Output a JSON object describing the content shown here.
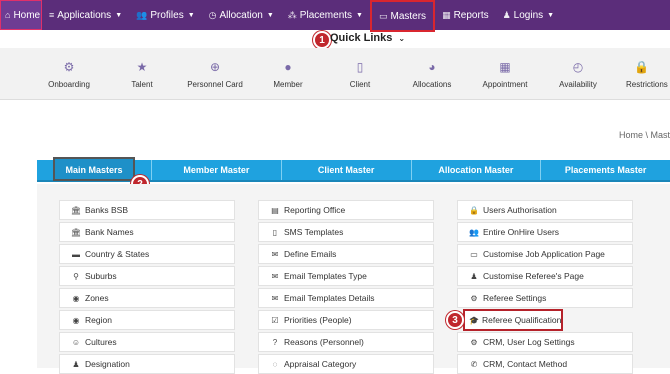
{
  "nav": {
    "items": [
      {
        "label": "Home",
        "icon": "home-icon",
        "glyph": "⌂",
        "caret": false
      },
      {
        "label": "Applications",
        "icon": "list-icon",
        "glyph": "≡",
        "caret": true
      },
      {
        "label": "Profiles",
        "icon": "users-icon",
        "glyph": "👥",
        "caret": true
      },
      {
        "label": "Allocation",
        "icon": "clock-icon",
        "glyph": "◷",
        "caret": true
      },
      {
        "label": "Placements",
        "icon": "sitemap-icon",
        "glyph": "⁂",
        "caret": true
      },
      {
        "label": "Masters",
        "icon": "window-icon",
        "glyph": "▭",
        "caret": false
      },
      {
        "label": "Reports",
        "icon": "chart-icon",
        "glyph": "▦",
        "caret": false
      },
      {
        "label": "Logins",
        "icon": "user-icon",
        "glyph": "♟",
        "caret": true
      }
    ]
  },
  "callouts": [
    "1",
    "2",
    "3"
  ],
  "quick_links": {
    "title": "Quick Links",
    "items": [
      {
        "label": "Onboarding",
        "icon": "gear-icon",
        "glyph": "⚙"
      },
      {
        "label": "Talent",
        "icon": "star-icon",
        "glyph": "★"
      },
      {
        "label": "Personnel Card",
        "icon": "search-icon",
        "glyph": "⊕"
      },
      {
        "label": "Member",
        "icon": "user-icon",
        "glyph": "●"
      },
      {
        "label": "Client",
        "icon": "document-icon",
        "glyph": "▯"
      },
      {
        "label": "Allocations",
        "icon": "pie-chart-icon",
        "glyph": "◕"
      },
      {
        "label": "Appointment",
        "icon": "calendar-icon",
        "glyph": "▦"
      },
      {
        "label": "Availability",
        "icon": "clock-icon",
        "glyph": "◴"
      },
      {
        "label": "Restrictions",
        "icon": "lock-icon",
        "glyph": "🔒"
      }
    ]
  },
  "breadcrumb": "Home \\ Mast",
  "tabs": [
    "Main Masters",
    "Member Master",
    "Client Master",
    "Allocation Master",
    "Placements Master"
  ],
  "columns": [
    [
      {
        "label": "Banks BSB",
        "icon": "bank-icon",
        "glyph": "🏛"
      },
      {
        "label": "Bank Names",
        "icon": "bank-icon",
        "glyph": "🏛"
      },
      {
        "label": "Country & States",
        "icon": "flag-icon",
        "glyph": "▬"
      },
      {
        "label": "Suburbs",
        "icon": "map-marker-icon",
        "glyph": "⚲"
      },
      {
        "label": "Zones",
        "icon": "globe-icon",
        "glyph": "◉"
      },
      {
        "label": "Region",
        "icon": "globe-icon",
        "glyph": "◉"
      },
      {
        "label": "Cultures",
        "icon": "smile-icon",
        "glyph": "☺"
      },
      {
        "label": "Designation",
        "icon": "user-icon",
        "glyph": "♟"
      }
    ],
    [
      {
        "label": "Reporting Office",
        "icon": "file-icon",
        "glyph": "▤"
      },
      {
        "label": "SMS Templates",
        "icon": "mobile-icon",
        "glyph": "▯"
      },
      {
        "label": "Define Emails",
        "icon": "envelope-icon",
        "glyph": "✉"
      },
      {
        "label": "Email Templates Type",
        "icon": "envelope-icon",
        "glyph": "✉"
      },
      {
        "label": "Email Templates Details",
        "icon": "envelope-icon",
        "glyph": "✉"
      },
      {
        "label": "Priorities (People)",
        "icon": "check-square-icon",
        "glyph": "☑"
      },
      {
        "label": "Reasons (Personnel)",
        "icon": "question-circle-icon",
        "glyph": "?"
      },
      {
        "label": "Appraisal Category",
        "icon": "comment-icon",
        "glyph": "◌"
      }
    ],
    [
      {
        "label": "Users Authorisation",
        "icon": "lock-icon",
        "glyph": "🔒"
      },
      {
        "label": "Entire OnHire Users",
        "icon": "users-icon",
        "glyph": "👥"
      },
      {
        "label": "Customise Job Application Page",
        "icon": "window-icon",
        "glyph": "▭"
      },
      {
        "label": "Customise Referee's Page",
        "icon": "user-plus-icon",
        "glyph": "♟"
      },
      {
        "label": "Referee Settings",
        "icon": "gears-icon",
        "glyph": "⚙"
      },
      {
        "label": "Referee Qualification",
        "icon": "graduation-cap-icon",
        "glyph": "🎓"
      },
      {
        "label": "CRM, User Log Settings",
        "icon": "gear-icon",
        "glyph": "⚙"
      },
      {
        "label": "CRM, Contact Method",
        "icon": "phone-icon",
        "glyph": "✆"
      }
    ]
  ]
}
